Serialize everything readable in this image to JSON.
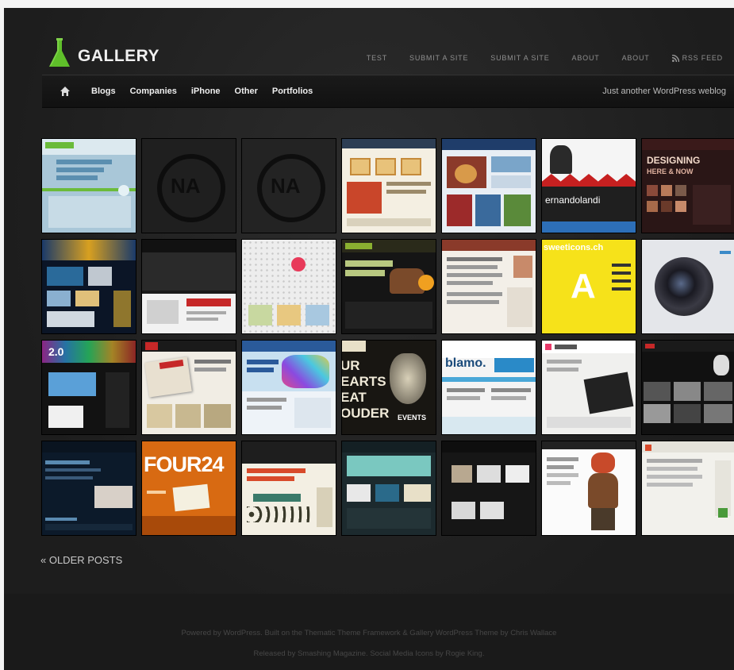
{
  "site": {
    "name": "GALLERY",
    "tagline": "Just another WordPress weblog"
  },
  "top_nav": [
    "TEST",
    "SUBMIT A SITE",
    "SUBMIT A SITE",
    "ABOUT",
    "ABOUT",
    "RSS FEED"
  ],
  "categories": [
    "Blogs",
    "Companies",
    "iPhone",
    "Other",
    "Portfolios"
  ],
  "thumbnails": {
    "na_label": "NA",
    "fansite_label": "ernandolandi",
    "designing_label": "DESIGNING",
    "designing_sub": "HERE & NOW",
    "iconsite_label": "sweeticons.ch",
    "big_a": "A",
    "version_badge": "2.0",
    "blamo_label": "blamo.",
    "hearts_lines": [
      "UR",
      "EARTS",
      "EAT",
      "OUDER"
    ],
    "events_label": "EVENTS",
    "four24_label": "FOUR24"
  },
  "older_posts": "« OLDER POSTS",
  "footer": {
    "line1": "Powered by WordPress. Built on the Thematic Theme Framework & Gallery WordPress Theme by Chris Wallace",
    "line2": "Released by Smashing Magazine. Social Media Icons by Rogie King."
  },
  "colors": {
    "background": "#222222",
    "accent_green": "#5fbf2a"
  }
}
